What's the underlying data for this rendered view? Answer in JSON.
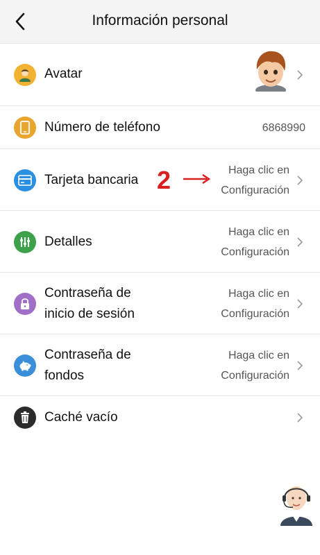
{
  "header": {
    "title": "Información personal"
  },
  "rows": [
    {
      "label": "Avatar"
    },
    {
      "label": "Número de teléfono",
      "value": "6868990"
    },
    {
      "label": "Tarjeta bancaria",
      "value_line1": "Haga clic en",
      "value_line2": "Configuración"
    },
    {
      "label": "Detalles",
      "value_line1": "Haga clic en",
      "value_line2": "Configuración"
    },
    {
      "label_line1": "Contraseña de",
      "label_line2": "inicio de sesión",
      "value_line1": "Haga clic en",
      "value_line2": "Configuración"
    },
    {
      "label_line1": "Contraseña de",
      "label_line2": "fondos",
      "value_line1": "Haga clic en",
      "value_line2": "Configuración"
    },
    {
      "label": "Caché vacío"
    }
  ],
  "annotation": {
    "number": "2",
    "arrow": "→"
  },
  "icons": {
    "back": "back-arrow-icon",
    "avatar": "person-icon",
    "phone": "phone-icon",
    "card": "credit-card-icon",
    "details": "sliders-icon",
    "login_password": "lock-icon",
    "fund_password": "piggy-bank-icon",
    "cache": "trash-icon",
    "chevron": "chevron-right-icon",
    "support": "customer-service-icon"
  },
  "colors": {
    "avatar_icon": "#f2b233",
    "phone_icon": "#e8a62e",
    "card_icon": "#2a8fe0",
    "details_icon": "#3ca14a",
    "login_password_icon": "#a070c8",
    "fund_password_icon": "#3a8fd8",
    "cache_icon": "#2b2b2b",
    "annotation": "#d92020"
  }
}
